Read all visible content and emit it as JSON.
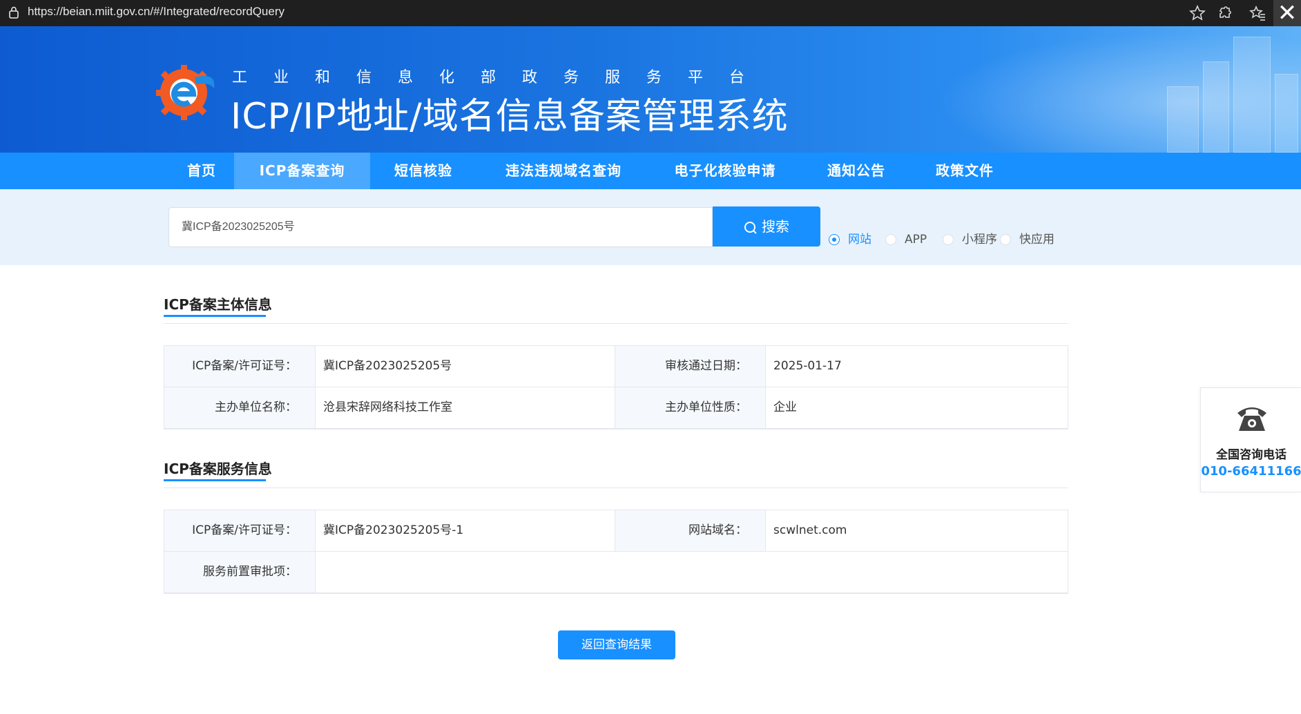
{
  "browser": {
    "url": "https://beian.miit.gov.cn/#/Integrated/recordQuery",
    "icons": [
      "lock-icon",
      "star-icon",
      "extensions-icon",
      "favorites-icon",
      "close-icon"
    ]
  },
  "header": {
    "subtitle": "工业和信息化部政务服务平台",
    "title": "ICP/IP地址/域名信息备案管理系统",
    "colors": {
      "banner": "#1a74e0",
      "logo_orange": "#f15a22",
      "logo_blue": "#1e8ce3"
    }
  },
  "nav": {
    "items": [
      {
        "label": "首页"
      },
      {
        "label": "ICP备案查询",
        "active": true
      },
      {
        "label": "短信核验"
      },
      {
        "label": "违法违规域名查询"
      },
      {
        "label": "电子化核验申请"
      },
      {
        "label": "通知公告"
      },
      {
        "label": "政策文件"
      }
    ],
    "colors": {
      "bg": "#1890ff",
      "active": "#4aa8ff"
    }
  },
  "search": {
    "value": "冀ICP备2023025205号",
    "button_label": "搜索",
    "types": [
      {
        "label": "网站",
        "checked": true
      },
      {
        "label": "APP",
        "checked": false
      },
      {
        "label": "小程序",
        "checked": false
      },
      {
        "label": "快应用",
        "checked": false
      }
    ]
  },
  "subject": {
    "title": "ICP备案主体信息",
    "rows": [
      [
        {
          "label": "ICP备案/许可证号：",
          "value": "冀ICP备2023025205号"
        },
        {
          "label": "审核通过日期：",
          "value": "2025-01-17"
        }
      ],
      [
        {
          "label": "主办单位名称：",
          "value": "沧县宋辞网络科技工作室"
        },
        {
          "label": "主办单位性质：",
          "value": "企业"
        }
      ]
    ]
  },
  "service": {
    "title": "ICP备案服务信息",
    "row1": [
      {
        "label": "ICP备案/许可证号：",
        "value": "冀ICP备2023025205号-1"
      },
      {
        "label": "网站域名：",
        "value": "scwlnet.com"
      }
    ],
    "row2": {
      "label": "服务前置审批项：",
      "value": ""
    }
  },
  "back_button": "返回查询结果",
  "consult": {
    "title": "全国咨询电话",
    "phone": "010-66411166"
  }
}
